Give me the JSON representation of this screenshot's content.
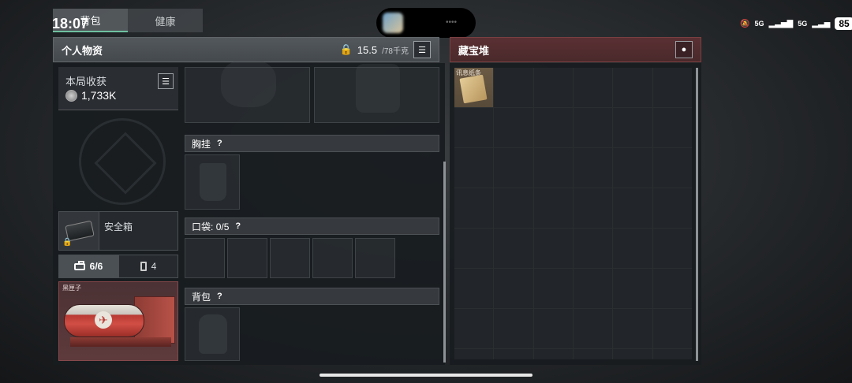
{
  "status": {
    "time": "18:07",
    "network": "5G",
    "network2": "5G",
    "battery": "85",
    "island_text": "••••"
  },
  "tabs": [
    {
      "label": "背包",
      "active": true
    },
    {
      "label": "健康",
      "active": false
    }
  ],
  "personal": {
    "title": "个人物资",
    "weight_current": "15.5",
    "weight_max": "/78千克"
  },
  "summary": {
    "label": "本局收获",
    "value": "1,733K"
  },
  "safebox": {
    "name": "安全箱"
  },
  "subtabs": [
    {
      "value": "6/6",
      "icon": "briefcase-icon",
      "active": true
    },
    {
      "value": "4",
      "icon": "battery-icon",
      "active": false
    }
  ],
  "blackbox": {
    "label": "黑匣子"
  },
  "sections": {
    "chest_rig": {
      "label": "胸挂",
      "help": "?"
    },
    "pockets": {
      "label": "口袋:",
      "count": "0/5",
      "help": "?"
    },
    "backpack": {
      "label": "背包",
      "help": "?"
    }
  },
  "stash": {
    "title": "藏宝堆",
    "items": [
      {
        "label": "讯息纸条",
        "icon": "paper-note-icon"
      }
    ]
  },
  "colors": {
    "accent_green": "#6fc0a0",
    "stash_red": "#7a3f41"
  }
}
